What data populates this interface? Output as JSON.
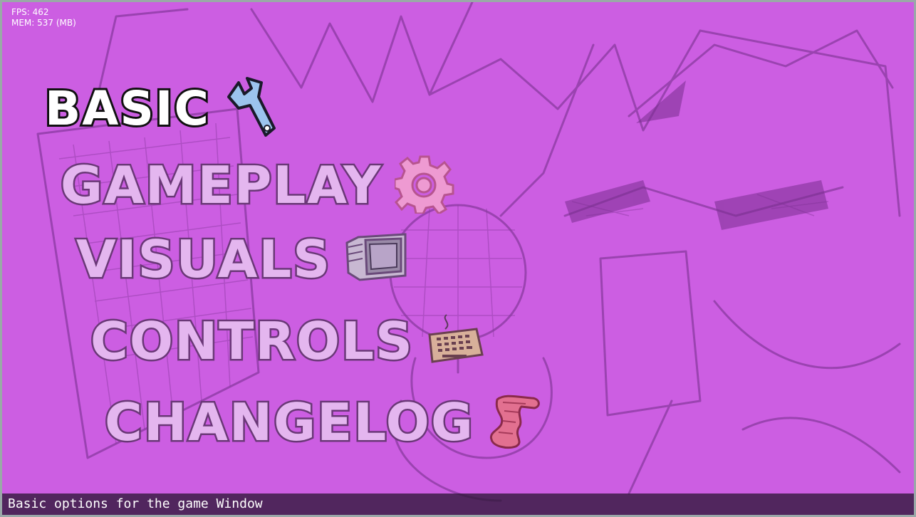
{
  "performance": {
    "fps_label": "FPS: 462",
    "mem_label": "MEM: 537 (MB)"
  },
  "menu": {
    "selected_index": 0,
    "items": [
      {
        "label": "BASIC",
        "icon": "wrench-icon",
        "selected": true
      },
      {
        "label": "GAMEPLAY",
        "icon": "gear-icon",
        "selected": false
      },
      {
        "label": "VISUALS",
        "icon": "monitor-icon",
        "selected": false
      },
      {
        "label": "CONTROLS",
        "icon": "keyboard-icon",
        "selected": false
      },
      {
        "label": "CHANGELOG",
        "icon": "scroll-icon",
        "selected": false
      }
    ]
  },
  "description": {
    "text": "Basic options for the game Window"
  },
  "colors": {
    "background": "#cc5ee2",
    "unselected_text": "#e4b6ef",
    "unselected_outline": "#6a3877",
    "selected_text": "#ffffff",
    "selected_outline": "#111111",
    "wrench": "#9cc4ee",
    "gear": "#ee9ad2",
    "scroll": "#e27090"
  }
}
